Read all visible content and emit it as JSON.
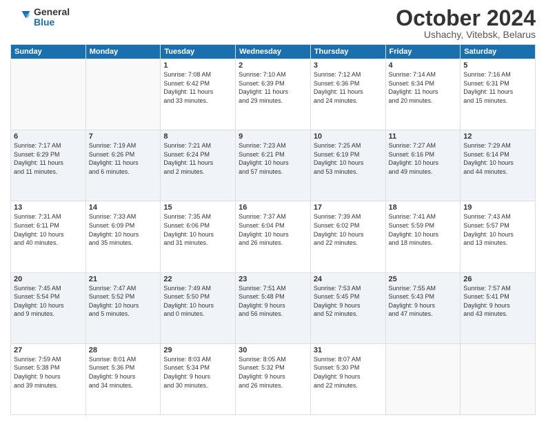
{
  "logo": {
    "general": "General",
    "blue": "Blue"
  },
  "header": {
    "month": "October 2024",
    "location": "Ushachy, Vitebsk, Belarus"
  },
  "days": [
    "Sunday",
    "Monday",
    "Tuesday",
    "Wednesday",
    "Thursday",
    "Friday",
    "Saturday"
  ],
  "weeks": [
    [
      {
        "day": "",
        "info": ""
      },
      {
        "day": "",
        "info": ""
      },
      {
        "day": "1",
        "info": "Sunrise: 7:08 AM\nSunset: 6:42 PM\nDaylight: 11 hours\nand 33 minutes."
      },
      {
        "day": "2",
        "info": "Sunrise: 7:10 AM\nSunset: 6:39 PM\nDaylight: 11 hours\nand 29 minutes."
      },
      {
        "day": "3",
        "info": "Sunrise: 7:12 AM\nSunset: 6:36 PM\nDaylight: 11 hours\nand 24 minutes."
      },
      {
        "day": "4",
        "info": "Sunrise: 7:14 AM\nSunset: 6:34 PM\nDaylight: 11 hours\nand 20 minutes."
      },
      {
        "day": "5",
        "info": "Sunrise: 7:16 AM\nSunset: 6:31 PM\nDaylight: 11 hours\nand 15 minutes."
      }
    ],
    [
      {
        "day": "6",
        "info": "Sunrise: 7:17 AM\nSunset: 6:29 PM\nDaylight: 11 hours\nand 11 minutes."
      },
      {
        "day": "7",
        "info": "Sunrise: 7:19 AM\nSunset: 6:26 PM\nDaylight: 11 hours\nand 6 minutes."
      },
      {
        "day": "8",
        "info": "Sunrise: 7:21 AM\nSunset: 6:24 PM\nDaylight: 11 hours\nand 2 minutes."
      },
      {
        "day": "9",
        "info": "Sunrise: 7:23 AM\nSunset: 6:21 PM\nDaylight: 10 hours\nand 57 minutes."
      },
      {
        "day": "10",
        "info": "Sunrise: 7:25 AM\nSunset: 6:19 PM\nDaylight: 10 hours\nand 53 minutes."
      },
      {
        "day": "11",
        "info": "Sunrise: 7:27 AM\nSunset: 6:16 PM\nDaylight: 10 hours\nand 49 minutes."
      },
      {
        "day": "12",
        "info": "Sunrise: 7:29 AM\nSunset: 6:14 PM\nDaylight: 10 hours\nand 44 minutes."
      }
    ],
    [
      {
        "day": "13",
        "info": "Sunrise: 7:31 AM\nSunset: 6:11 PM\nDaylight: 10 hours\nand 40 minutes."
      },
      {
        "day": "14",
        "info": "Sunrise: 7:33 AM\nSunset: 6:09 PM\nDaylight: 10 hours\nand 35 minutes."
      },
      {
        "day": "15",
        "info": "Sunrise: 7:35 AM\nSunset: 6:06 PM\nDaylight: 10 hours\nand 31 minutes."
      },
      {
        "day": "16",
        "info": "Sunrise: 7:37 AM\nSunset: 6:04 PM\nDaylight: 10 hours\nand 26 minutes."
      },
      {
        "day": "17",
        "info": "Sunrise: 7:39 AM\nSunset: 6:02 PM\nDaylight: 10 hours\nand 22 minutes."
      },
      {
        "day": "18",
        "info": "Sunrise: 7:41 AM\nSunset: 5:59 PM\nDaylight: 10 hours\nand 18 minutes."
      },
      {
        "day": "19",
        "info": "Sunrise: 7:43 AM\nSunset: 5:57 PM\nDaylight: 10 hours\nand 13 minutes."
      }
    ],
    [
      {
        "day": "20",
        "info": "Sunrise: 7:45 AM\nSunset: 5:54 PM\nDaylight: 10 hours\nand 9 minutes."
      },
      {
        "day": "21",
        "info": "Sunrise: 7:47 AM\nSunset: 5:52 PM\nDaylight: 10 hours\nand 5 minutes."
      },
      {
        "day": "22",
        "info": "Sunrise: 7:49 AM\nSunset: 5:50 PM\nDaylight: 10 hours\nand 0 minutes."
      },
      {
        "day": "23",
        "info": "Sunrise: 7:51 AM\nSunset: 5:48 PM\nDaylight: 9 hours\nand 56 minutes."
      },
      {
        "day": "24",
        "info": "Sunrise: 7:53 AM\nSunset: 5:45 PM\nDaylight: 9 hours\nand 52 minutes."
      },
      {
        "day": "25",
        "info": "Sunrise: 7:55 AM\nSunset: 5:43 PM\nDaylight: 9 hours\nand 47 minutes."
      },
      {
        "day": "26",
        "info": "Sunrise: 7:57 AM\nSunset: 5:41 PM\nDaylight: 9 hours\nand 43 minutes."
      }
    ],
    [
      {
        "day": "27",
        "info": "Sunrise: 7:59 AM\nSunset: 5:38 PM\nDaylight: 9 hours\nand 39 minutes."
      },
      {
        "day": "28",
        "info": "Sunrise: 8:01 AM\nSunset: 5:36 PM\nDaylight: 9 hours\nand 34 minutes."
      },
      {
        "day": "29",
        "info": "Sunrise: 8:03 AM\nSunset: 5:34 PM\nDaylight: 9 hours\nand 30 minutes."
      },
      {
        "day": "30",
        "info": "Sunrise: 8:05 AM\nSunset: 5:32 PM\nDaylight: 9 hours\nand 26 minutes."
      },
      {
        "day": "31",
        "info": "Sunrise: 8:07 AM\nSunset: 5:30 PM\nDaylight: 9 hours\nand 22 minutes."
      },
      {
        "day": "",
        "info": ""
      },
      {
        "day": "",
        "info": ""
      }
    ]
  ]
}
